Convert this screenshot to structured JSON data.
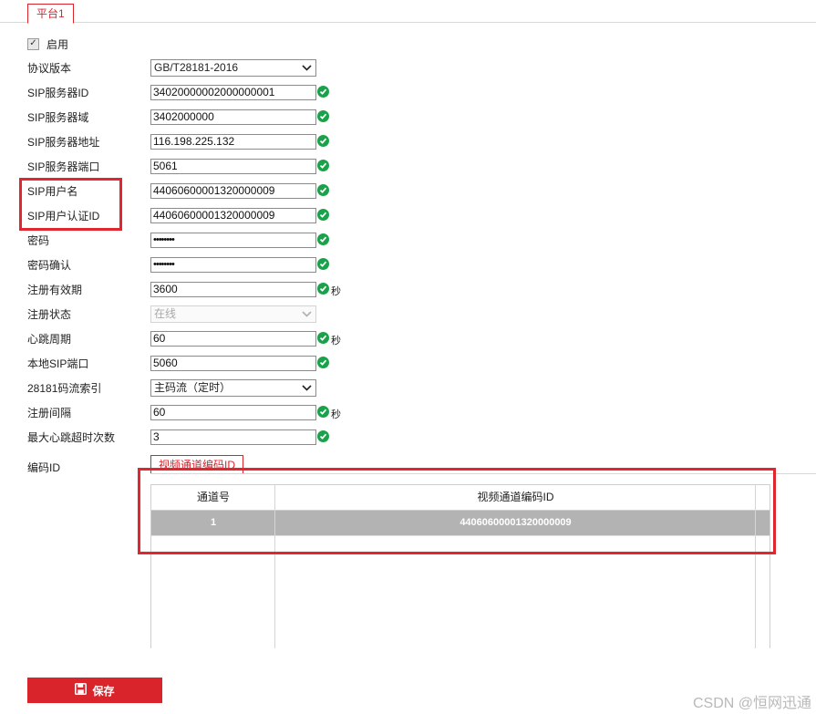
{
  "platform_tab": "平台1",
  "enable": {
    "label": "启用",
    "checked": true
  },
  "fields": {
    "protocol_version": {
      "label": "协议版本",
      "value": "GB/T28181-2016"
    },
    "sip_server_id": {
      "label": "SIP服务器ID",
      "value": "34020000002000000001"
    },
    "sip_server_domain": {
      "label": "SIP服务器域",
      "value": "3402000000"
    },
    "sip_server_address": {
      "label": "SIP服务器地址",
      "value": "116.198.225.132"
    },
    "sip_server_port": {
      "label": "SIP服务器端口",
      "value": "5061"
    },
    "sip_username": {
      "label": "SIP用户名",
      "value": "44060600001320000009"
    },
    "sip_auth_id": {
      "label": "SIP用户认证ID",
      "value": "44060600001320000009"
    },
    "password": {
      "label": "密码",
      "value": "••••••••"
    },
    "password_confirm": {
      "label": "密码确认",
      "value": "••••••••"
    },
    "register_validity": {
      "label": "注册有效期",
      "value": "3600",
      "unit": "秒"
    },
    "register_status": {
      "label": "注册状态",
      "value": "在线"
    },
    "heartbeat_period": {
      "label": "心跳周期",
      "value": "60",
      "unit": "秒"
    },
    "local_sip_port": {
      "label": "本地SIP端口",
      "value": "5060"
    },
    "stream_index": {
      "label": "28181码流索引",
      "value": "主码流（定时）"
    },
    "register_interval": {
      "label": "注册间隔",
      "value": "60",
      "unit": "秒"
    },
    "max_heartbeat_timeouts": {
      "label": "最大心跳超时次数",
      "value": "3"
    }
  },
  "code_id": {
    "label": "编码ID",
    "tab": "视频通道编码ID",
    "columns": [
      "通道号",
      "视频通道编码ID"
    ],
    "rows": [
      {
        "channel": "1",
        "code_id": "44060600001320000009"
      }
    ]
  },
  "save_button": "保存",
  "watermark": "CSDN @恒网迅通",
  "colors": {
    "accent": "#d9242c",
    "ok": "#1aa24b",
    "selected_row": "#b3b3b3"
  }
}
